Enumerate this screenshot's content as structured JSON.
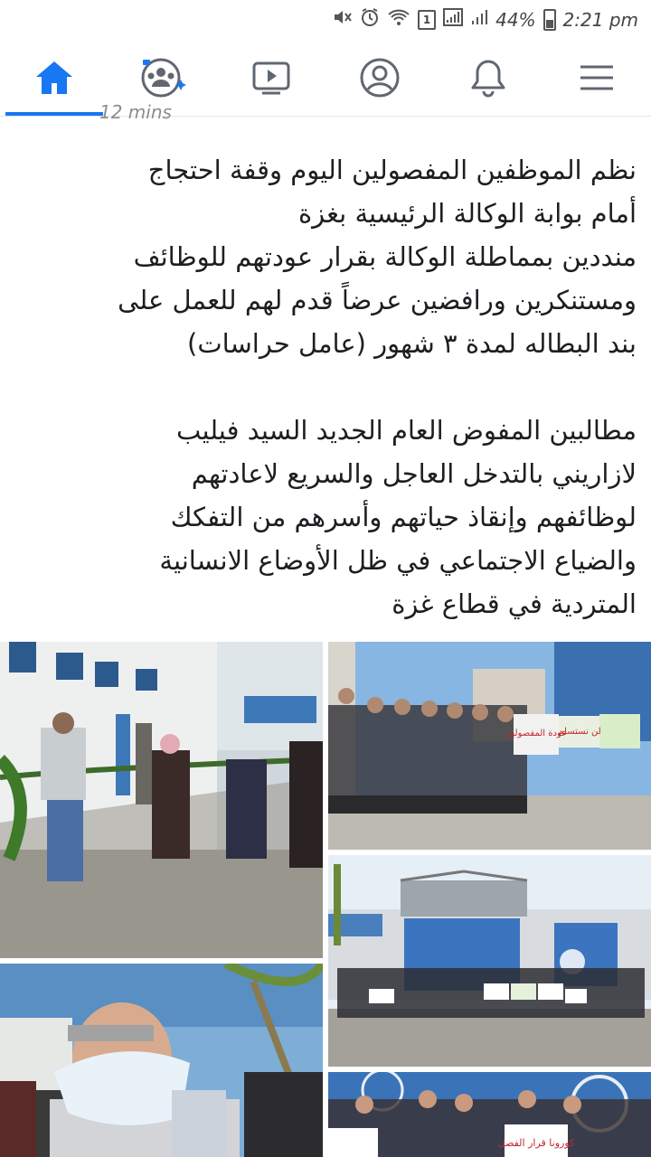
{
  "status_bar": {
    "battery_percent": "44%",
    "time": "2:21 pm",
    "notification_count": "1",
    "icons": [
      "mute-icon",
      "alarm-icon",
      "wifi-icon",
      "notification-badge-icon",
      "signal-icon",
      "signal-icon",
      "battery-icon"
    ]
  },
  "nav": {
    "items": [
      {
        "name": "home",
        "icon": "home-icon",
        "active": true
      },
      {
        "name": "groups",
        "icon": "groups-icon",
        "active": false
      },
      {
        "name": "watch",
        "icon": "video-icon",
        "active": false
      },
      {
        "name": "profile",
        "icon": "profile-icon",
        "active": false
      },
      {
        "name": "notifications",
        "icon": "bell-icon",
        "active": false
      },
      {
        "name": "menu",
        "icon": "hamburger-menu-icon",
        "active": false
      }
    ],
    "accent": "#1877f2"
  },
  "post": {
    "timestamp": "12 mins",
    "lines1": [
      "نظم الموظفين المفصولين اليوم وقفة احتجاج",
      "أمام بوابة الوكالة الرئيسية بغزة",
      "منددين بمماطلة الوكالة بقرار عودتهم للوظائف",
      "ومستنكرين ورافضين عرضاً قدم لهم للعمل على",
      "بند البطاله لمدة ٣ شهور (عامل حراسات)"
    ],
    "lines2": [
      "مطالبين المفوض العام الجديد السيد فيليب",
      "لازاريني بالتدخل العاجل والسريع لاعادتهم",
      "لوظائفهم وإنقاذ حياتهم وأسرهم من التفكك",
      "والضياع الاجتماعي في ظل الأوضاع الانسانية",
      "المتردية في قطاع غزة"
    ]
  },
  "photos": {
    "sign_texts": [
      "عودة المفصولين",
      "لن نستسلم",
      "كورونا قرار الفصل"
    ]
  }
}
